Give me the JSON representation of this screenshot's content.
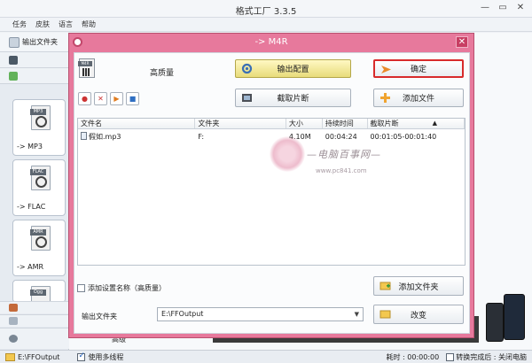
{
  "app": {
    "title": "格式工厂 3.3.5",
    "menu": [
      "任务",
      "皮肤",
      "语言",
      "帮助"
    ],
    "window_buttons": [
      "—",
      "▭",
      "✕"
    ]
  },
  "left_panel": {
    "header_label": "输出文件夹",
    "formats": [
      {
        "tag": "MP3",
        "label": "-> MP3"
      },
      {
        "tag": "FLAC",
        "label": "-> FLAC"
      },
      {
        "tag": "AMR",
        "label": "-> AMR"
      },
      {
        "tag": "Ogg",
        "label": ""
      }
    ],
    "grade_label": "高级"
  },
  "dialog": {
    "title": "-> M4R",
    "close": "✕",
    "quality": "高质量",
    "buttons": {
      "output_config": "输出配置",
      "ok": "确定",
      "clip": "截取片断",
      "add_file": "添加文件",
      "add_folder": "添加文件夹",
      "change": "改变"
    },
    "columns": [
      "文件名",
      "文件夹",
      "大小",
      "持续时间",
      "截取片断"
    ],
    "rows": [
      {
        "name": "假如.mp3",
        "folder": "F:",
        "size": "4.10M",
        "duration": "00:04:24",
        "clip": "00:01:05-00:01:40"
      }
    ],
    "watermark": {
      "text": "—电脑百事网—",
      "url": "www.pc841.com"
    },
    "add_setting_name_label": "添加设置名称（高质量）",
    "output_folder_label": "输出文件夹",
    "output_folder_value": "E:\\FFOutput"
  },
  "status": {
    "output_path": "E:\\FFOutput",
    "multithread_label": "使用多线程",
    "elapsed_label": "耗时 : 00:00:00",
    "after_convert_label": "转换完成后 : 关闭电脑"
  },
  "colors": {
    "dialog_frame": "#e7799c",
    "ok_highlight": "#d82b2b",
    "output_config_button": "#e8dc7a"
  }
}
